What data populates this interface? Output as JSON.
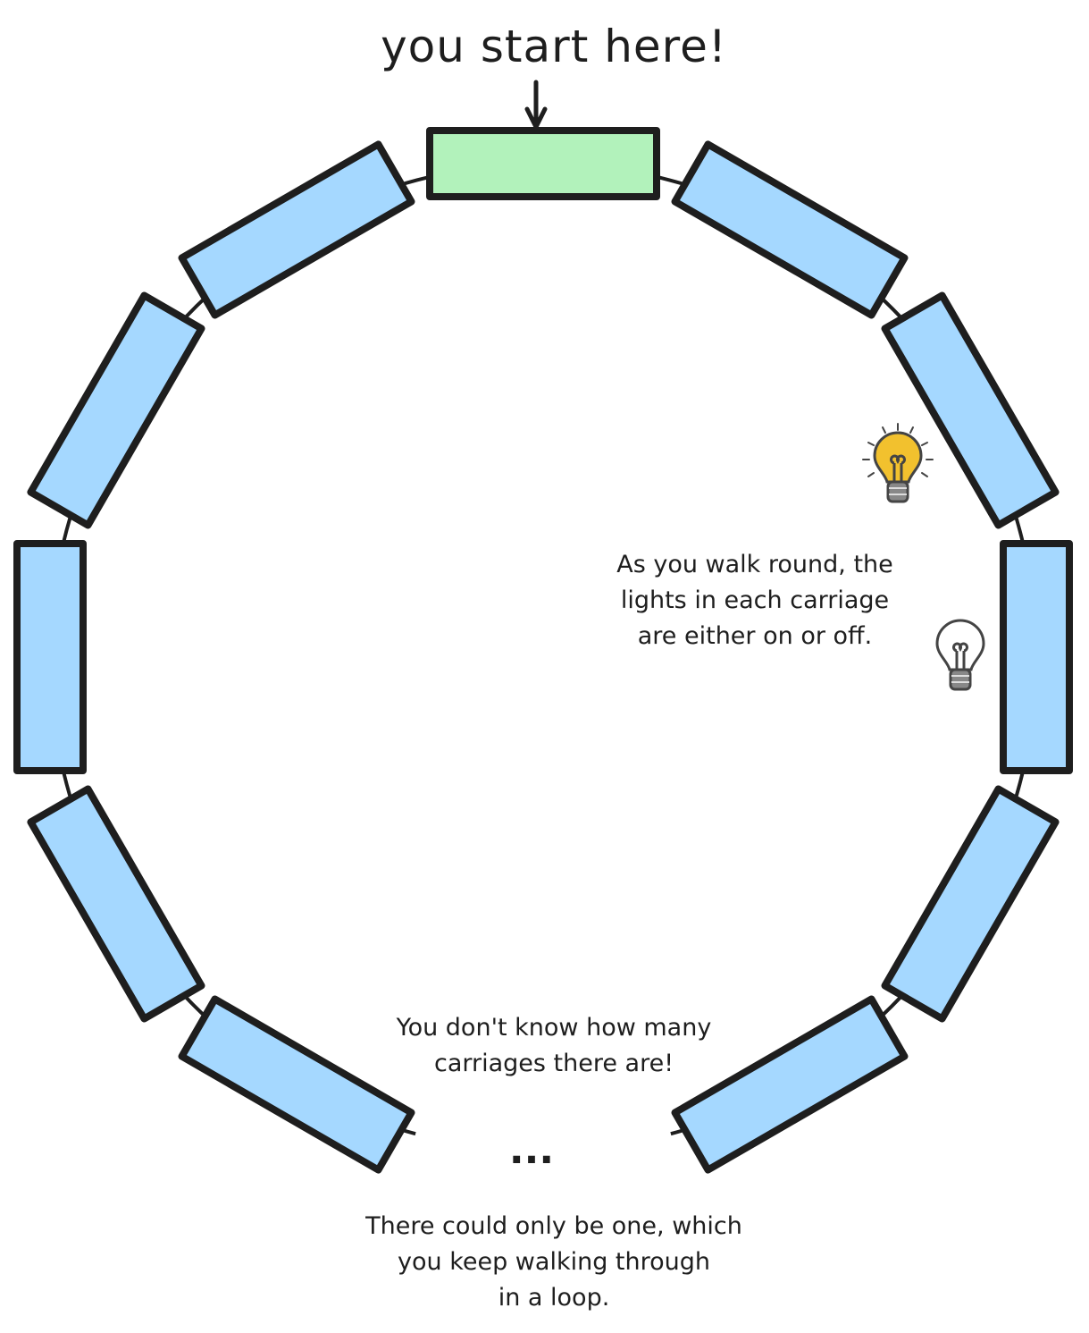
{
  "title": "you start here!",
  "annotations": {
    "lights": "As you walk round, the\nlights in each carriage\nare either on or off.",
    "count": "You don't know how many\ncarriages there are!",
    "loop": "There could only be one, which\nyou keep walking through\nin a loop.",
    "ellipsis": "..."
  },
  "icons": {
    "start_arrow": "arrow-down-icon",
    "light_on": "lightbulb-on-icon",
    "light_off": "lightbulb-off-icon"
  },
  "colors": {
    "start_carriage": "#b2f2bb",
    "carriage": "#a5d8ff",
    "stroke": "#1e1e1e",
    "bulb_on": "#f2c12e"
  }
}
